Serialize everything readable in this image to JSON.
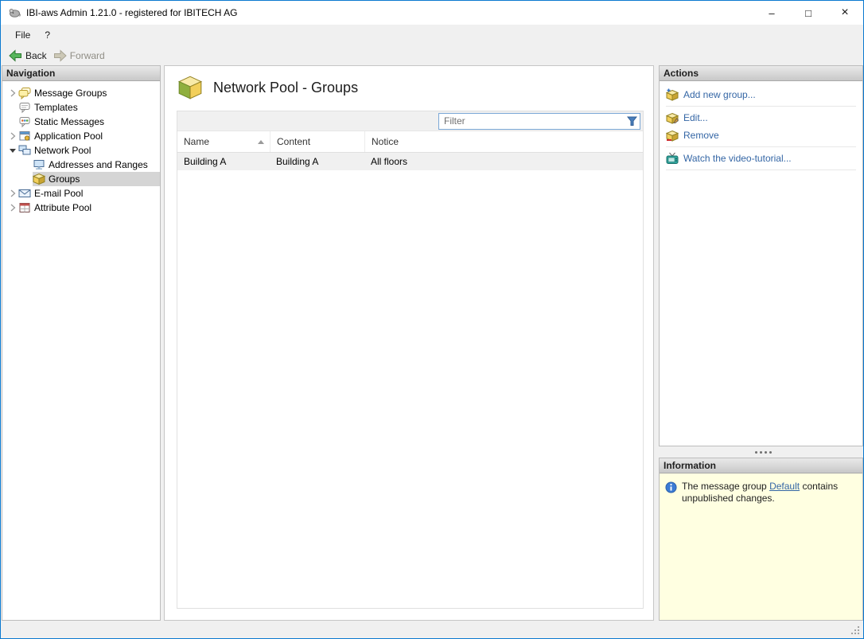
{
  "window": {
    "title": "IBI-aws Admin 1.21.0 - registered for IBITECH AG",
    "controls": {
      "minimize": "–",
      "maximize": "□",
      "close": "×"
    }
  },
  "menubar": {
    "items": [
      {
        "label": "File"
      },
      {
        "label": "?"
      }
    ]
  },
  "toolbar": {
    "back_label": "Back",
    "forward_label": "Forward"
  },
  "navigation": {
    "header": "Navigation",
    "items": [
      {
        "label": "Message Groups",
        "icon": "message-groups-icon",
        "level": 1,
        "state": "collapsed",
        "selected": false
      },
      {
        "label": "Templates",
        "icon": "templates-icon",
        "level": 1,
        "state": "leaf",
        "selected": false
      },
      {
        "label": "Static Messages",
        "icon": "static-messages-icon",
        "level": 1,
        "state": "leaf",
        "selected": false
      },
      {
        "label": "Application Pool",
        "icon": "application-pool-icon",
        "level": 1,
        "state": "collapsed",
        "selected": false
      },
      {
        "label": "Network Pool",
        "icon": "network-pool-icon",
        "level": 1,
        "state": "expanded",
        "selected": false
      },
      {
        "label": "Addresses and Ranges",
        "icon": "addresses-and-ranges-icon",
        "level": 2,
        "state": "leaf",
        "selected": false
      },
      {
        "label": "Groups",
        "icon": "groups-icon",
        "level": 2,
        "state": "leaf",
        "selected": true
      },
      {
        "label": "E-mail Pool",
        "icon": "email-pool-icon",
        "level": 1,
        "state": "collapsed",
        "selected": false
      },
      {
        "label": "Attribute Pool",
        "icon": "attribute-pool-icon",
        "level": 1,
        "state": "collapsed",
        "selected": false
      }
    ]
  },
  "main": {
    "title": "Network Pool - Groups",
    "filter": {
      "placeholder": "Filter"
    },
    "table": {
      "columns": [
        {
          "label": "Name",
          "sort": "ascending"
        },
        {
          "label": "Content"
        },
        {
          "label": "Notice"
        }
      ],
      "rows": [
        {
          "name": "Building A",
          "content": "Building A",
          "notice": "All floors"
        }
      ]
    }
  },
  "actions": {
    "header": "Actions",
    "items": [
      {
        "label": "Add new group...",
        "icon": "add-group-icon"
      },
      {
        "label": "Edit...",
        "icon": "edit-group-icon"
      },
      {
        "label": "Remove",
        "icon": "remove-group-icon"
      },
      {
        "label": "Watch the video-tutorial...",
        "icon": "video-tutorial-icon"
      }
    ]
  },
  "information": {
    "header": "Information",
    "message": {
      "text_before": "The message group",
      "link_text": "Default",
      "text_after": "contains unpublished changes."
    }
  },
  "colors": {
    "window_border": "#0b79d0",
    "link_blue": "#3466a5",
    "info_panel_bg": "#ffffe1",
    "selection_bg": "#d5d5d5",
    "group_box_yellow": "#f2cf5b",
    "group_box_green": "#8faf3e"
  }
}
